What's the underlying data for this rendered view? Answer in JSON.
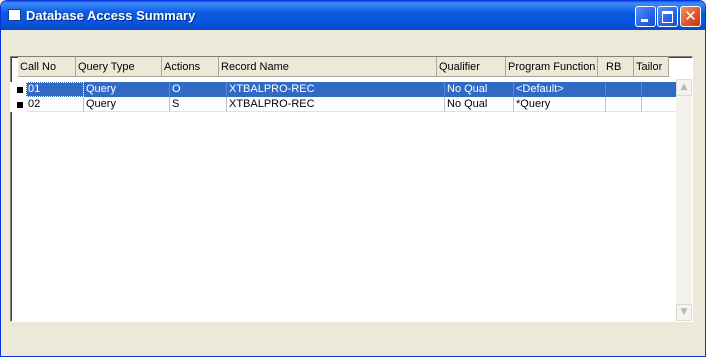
{
  "window": {
    "title": "Database Access Summary"
  },
  "table": {
    "columns": [
      "Call No",
      "Query Type",
      "Actions",
      "Record Name",
      "Qualifier",
      "Program Function",
      "RB",
      "Tailor"
    ],
    "rows": [
      {
        "call_no": "01",
        "query_type": "Query",
        "actions": "O",
        "record_name": "XTBALPRO-REC",
        "qualifier": "No Qual",
        "program_function": "<Default>",
        "rb": "",
        "tailor": "",
        "selected": true
      },
      {
        "call_no": "02",
        "query_type": "Query",
        "actions": "S",
        "record_name": "XTBALPRO-REC",
        "qualifier": "No Qual",
        "program_function": "*Query",
        "rb": "",
        "tailor": "",
        "selected": false
      }
    ]
  },
  "icons": {
    "scroll_up": "scroll-up-arrow-icon",
    "scroll_down": "scroll-down-arrow-icon",
    "close": "close-icon",
    "minimize": "minimize-icon",
    "maximize": "maximize-icon"
  },
  "colors": {
    "titlebar": "#0757e2",
    "selection": "#316ac5",
    "window_bg": "#ece9d8"
  }
}
